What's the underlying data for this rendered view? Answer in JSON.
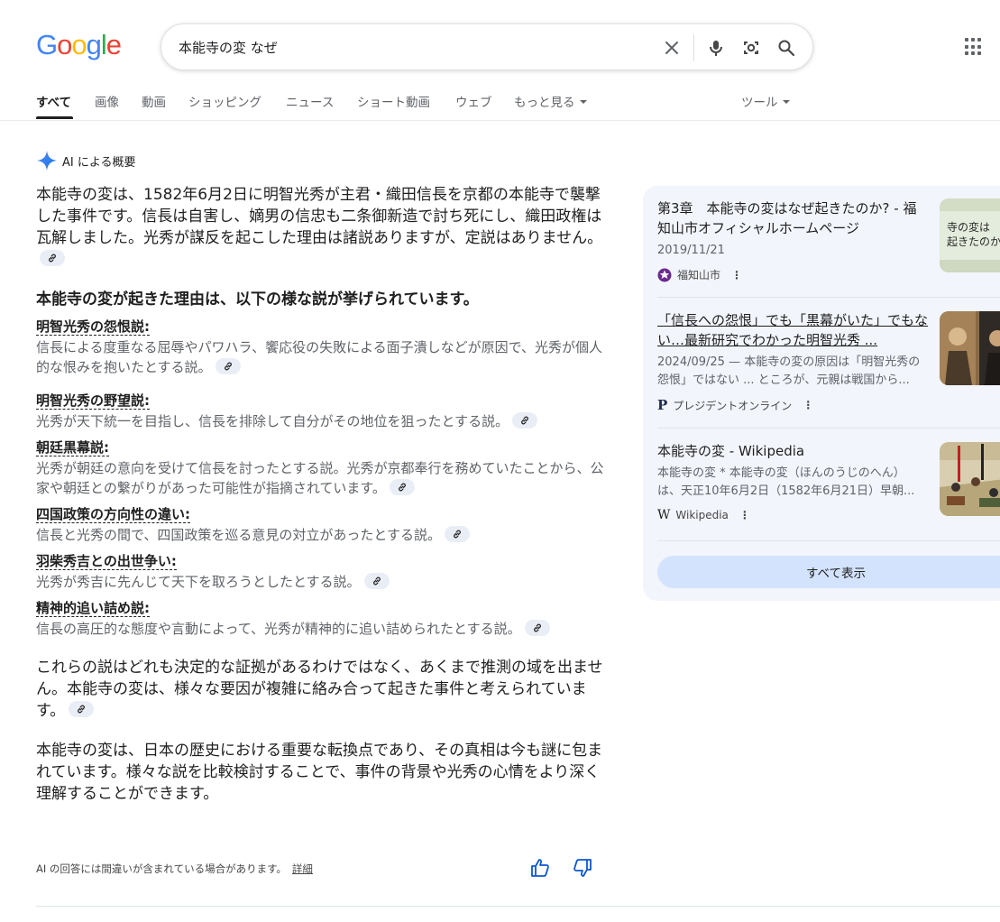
{
  "logo": [
    "G",
    "o",
    "o",
    "g",
    "l",
    "e"
  ],
  "search": {
    "query": "本能寺の変 なぜ"
  },
  "tabs": [
    "すべて",
    "画像",
    "動画",
    "ショッピング",
    "ニュース",
    "ショート動画",
    "ウェブ",
    "もっと見る",
    "ツール"
  ],
  "ai": {
    "title": "AI による概要",
    "intro": "本能寺の変は、1582年6月2日に明智光秀が主君・織田信長を京都の本能寺で襲撃した事件です。信長は自害し、嫡男の信忠も二条御新造で討ち死にし、織田政権は瓦解しました。光秀が謀反を起こした理由は諸説ありますが、定説はありません。",
    "heading": "本能寺の変が起きた理由は、以下の様な説が挙げられています。",
    "theories": [
      {
        "title": "明智光秀の怨恨説:",
        "desc": "信長による度重なる屈辱やパワハラ、饗応役の失敗による面子潰しなどが原因で、光秀が個人的な恨みを抱いたとする説。"
      },
      {
        "title": "明智光秀の野望説:",
        "desc": "光秀が天下統一を目指し、信長を排除して自分がその地位を狙ったとする説。"
      },
      {
        "title": "朝廷黒幕説:",
        "desc": "光秀が朝廷の意向を受けて信長を討ったとする説。光秀が京都奉行を務めていたことから、公家や朝廷との繋がりがあった可能性が指摘されています。"
      },
      {
        "title": "四国政策の方向性の違い:",
        "desc": "信長と光秀の間で、四国政策を巡る意見の対立があったとする説。"
      },
      {
        "title": "羽柴秀吉との出世争い:",
        "desc": "光秀が秀吉に先んじて天下を取ろうとしたとする説。"
      },
      {
        "title": "精神的追い詰め説:",
        "desc": "信長の高圧的な態度や言動によって、光秀が精神的に追い詰められたとする説。"
      }
    ],
    "conclusion1": "これらの説はどれも決定的な証拠があるわけではなく、あくまで推測の域を出ません。本能寺の変は、様々な要因が複雑に絡み合って起きた事件と考えられています。",
    "conclusion2": "本能寺の変は、日本の歴史における重要な転換点であり、その真相は今も謎に包まれています。様々な説を比較検討することで、事件の背景や光秀の心情をより深く理解することができます。",
    "disclaimer": "AI の回答には間違いが含まれている場合があります。",
    "details_link": "詳細"
  },
  "sources": [
    {
      "title": "第3章　本能寺の変はなぜ起きたのか? - 福知山市オフィシャルホームページ",
      "date": "2019/11/21",
      "site": "福知山市"
    },
    {
      "title": "「信長への怨恨」でも「黒幕がいた」でもない…最新研究でわかった明智光秀 ...",
      "snippet": "2024/09/25 — 本能寺の変の原因は「明智光秀の怨恨」ではない ... ところが、元親は戦国から...",
      "site": "プレジデントオンライン"
    },
    {
      "title": "本能寺の変 - Wikipedia",
      "snippet": "本能寺の変 * 本能寺の変（ほんのうじのへん）は、天正10年6月2日（1582年6月21日）早朝...",
      "site": "Wikipedia"
    }
  ],
  "show_all": "すべて表示",
  "thumb_text": {
    "line1": "寺の変は",
    "line2": "起きたのか"
  }
}
